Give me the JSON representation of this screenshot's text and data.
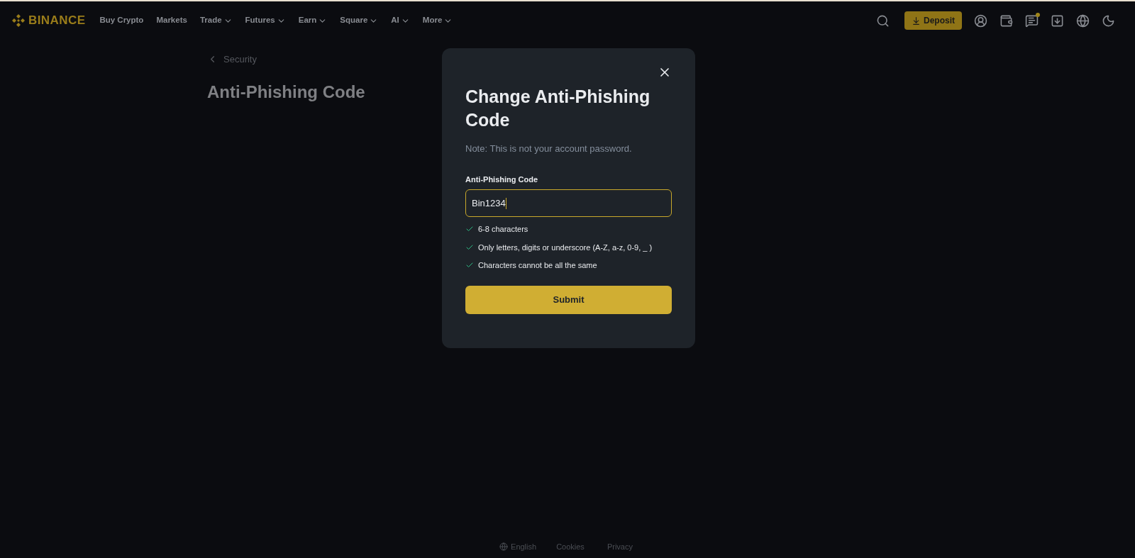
{
  "header": {
    "logo": "BINANCE",
    "nav": [
      {
        "label": "Buy Crypto",
        "has_menu": false
      },
      {
        "label": "Markets",
        "has_menu": false
      },
      {
        "label": "Trade",
        "has_menu": true
      },
      {
        "label": "Futures",
        "has_menu": true
      },
      {
        "label": "Earn",
        "has_menu": true
      },
      {
        "label": "Square",
        "has_menu": true
      },
      {
        "label": "AI",
        "has_menu": true
      },
      {
        "label": "More",
        "has_menu": true
      }
    ],
    "deposit_button": "Deposit",
    "messages_unread": true
  },
  "page": {
    "back_link": "Security",
    "title": "Anti-Phishing Code"
  },
  "dialog": {
    "title": "Change Anti-Phishing Code",
    "note": "Note: This is not your account password.",
    "field_label": "Anti-Phishing Code",
    "field_value": "Bin1234",
    "focused": true,
    "rules": [
      {
        "text": "6-8 characters",
        "met": true
      },
      {
        "text": "Only letters, digits or underscore (A-Z, a-z, 0-9, _ )",
        "met": true
      },
      {
        "text": "Characters cannot be all the same",
        "met": true
      }
    ],
    "submit": "Submit"
  },
  "footer": {
    "language": "English",
    "links": [
      "Cookies",
      "Privacy"
    ]
  }
}
